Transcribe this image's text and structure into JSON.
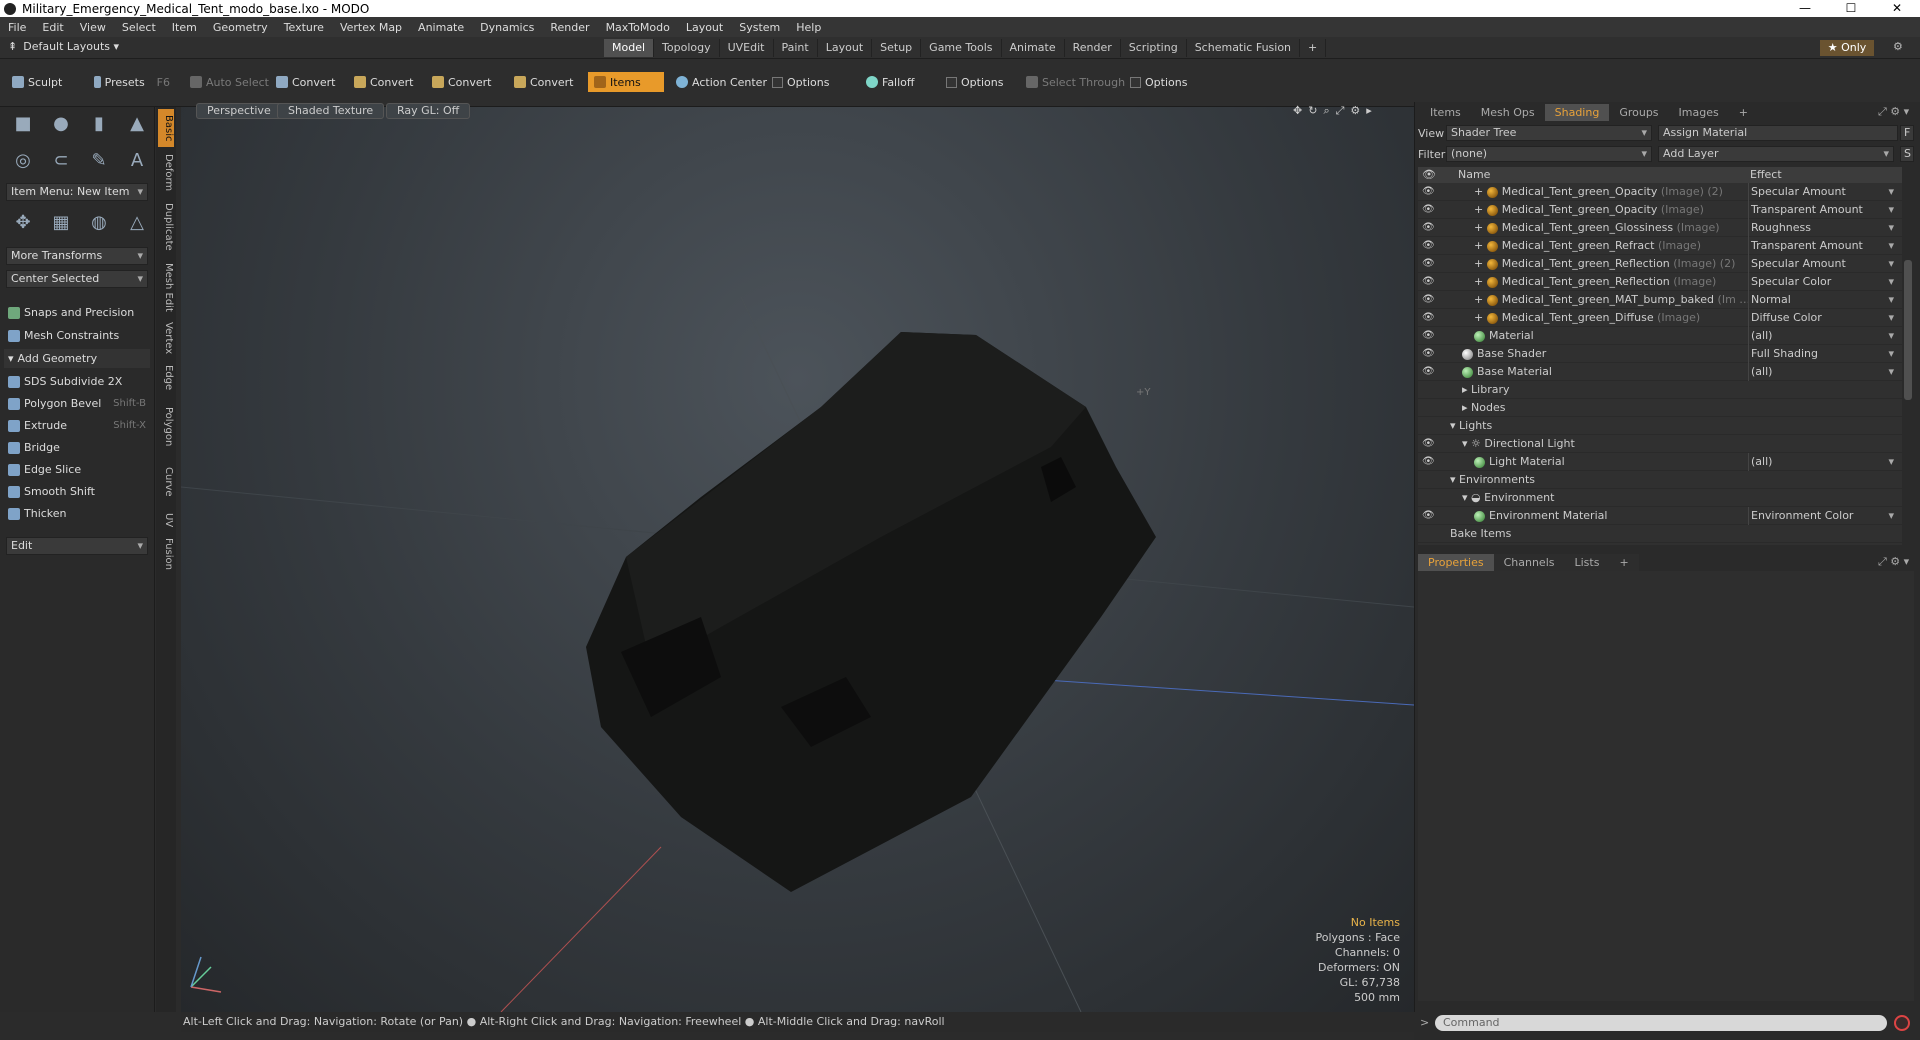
{
  "window": {
    "title": "Military_Emergency_Medical_Tent_modo_base.lxo - MODO",
    "min": "—",
    "max": "☐",
    "close": "✕"
  },
  "menu": [
    "File",
    "Edit",
    "View",
    "Select",
    "Item",
    "Geometry",
    "Texture",
    "Vertex Map",
    "Animate",
    "Dynamics",
    "Render",
    "MaxToModo",
    "Layout",
    "System",
    "Help"
  ],
  "layout": {
    "label": "Default Layouts ▾",
    "tabs": [
      "Model",
      "Topology",
      "UVEdit",
      "Paint",
      "Layout",
      "Setup",
      "Game Tools",
      "Animate",
      "Render",
      "Scripting",
      "Schematic Fusion",
      "+"
    ],
    "active_tab": "Model",
    "only": "★ Only"
  },
  "toolbar": {
    "sculpt": "Sculpt",
    "presets": "Presets",
    "presets_key": "F6",
    "auto_select": "Auto Select",
    "convert1": "Convert",
    "convert2": "Convert",
    "convert3": "Convert",
    "convert4": "Convert",
    "items": "Items",
    "action_center": "Action Center",
    "options1": "Options",
    "falloff": "Falloff",
    "options2": "Options",
    "select_through": "Select Through",
    "options3": "Options"
  },
  "left": {
    "item_menu": "Item Menu: New Item",
    "more_transforms": "More Transforms",
    "center_selected": "Center Selected",
    "snaps": "Snaps and Precision",
    "mesh_constraints": "Mesh Constraints",
    "add_geometry": "Add Geometry",
    "tools": [
      {
        "label": "SDS Subdivide 2X",
        "key": ""
      },
      {
        "label": "Polygon Bevel",
        "key": "Shift-B"
      },
      {
        "label": "Extrude",
        "key": "Shift-X"
      },
      {
        "label": "Bridge",
        "key": ""
      },
      {
        "label": "Edge Slice",
        "key": ""
      },
      {
        "label": "Smooth Shift",
        "key": ""
      },
      {
        "label": "Thicken",
        "key": ""
      }
    ],
    "edit": "Edit",
    "vtabs": [
      "Basic",
      "Deform",
      "Duplicate",
      "Mesh Edit",
      "Vertex",
      "Edge",
      "Polygon",
      "Curve",
      "UV",
      "Fusion"
    ]
  },
  "viewport": {
    "perspective": "Perspective",
    "shaded": "Shaded Texture",
    "raygl": "Ray GL: Off",
    "axis_label": "+Y",
    "stats": {
      "no_items": "No Items",
      "polygons": "Polygons : Face",
      "channels": "Channels: 0",
      "deformers": "Deformers: ON",
      "gl": "GL: 67,738",
      "size": "500 mm"
    }
  },
  "status": "Alt-Left Click and Drag: Navigation: Rotate (or Pan) ● Alt-Right Click and Drag: Navigation: Freewheel ● Alt-Middle Click and Drag: navRoll",
  "right": {
    "tabs": [
      "Items",
      "Mesh Ops",
      "Shading",
      "Groups",
      "Images",
      "+"
    ],
    "active_tab": "Shading",
    "view_label": "View",
    "view_value": "Shader Tree",
    "assign": "Assign Material",
    "f_btn": "F",
    "filter_label": "Filter",
    "filter_value": "(none)",
    "add_layer": "Add Layer",
    "s_btn": "S",
    "col_name": "Name",
    "col_effect": "Effect",
    "rows": [
      {
        "name": "Medical_Tent_green_Opacity",
        "sub": "(Image) (2)",
        "effect": "Specular Amount",
        "type": "img",
        "indent": 3,
        "plus": true,
        "eye": true
      },
      {
        "name": "Medical_Tent_green_Opacity",
        "sub": "(Image)",
        "effect": "Transparent Amount",
        "type": "img",
        "indent": 3,
        "plus": true,
        "eye": true
      },
      {
        "name": "Medical_Tent_green_Glossiness",
        "sub": "(Image)",
        "effect": "Roughness",
        "type": "img",
        "indent": 3,
        "plus": true,
        "eye": true
      },
      {
        "name": "Medical_Tent_green_Refract",
        "sub": "(Image)",
        "effect": "Transparent Amount",
        "type": "img",
        "indent": 3,
        "plus": true,
        "eye": true
      },
      {
        "name": "Medical_Tent_green_Reflection",
        "sub": "(Image) (2)",
        "effect": "Specular Amount",
        "type": "img",
        "indent": 3,
        "plus": true,
        "eye": true
      },
      {
        "name": "Medical_Tent_green_Reflection",
        "sub": "(Image)",
        "effect": "Specular Color",
        "type": "img",
        "indent": 3,
        "plus": true,
        "eye": true
      },
      {
        "name": "Medical_Tent_green_MAT_bump_baked",
        "sub": "(Im …",
        "effect": "Normal",
        "type": "img",
        "indent": 3,
        "plus": true,
        "eye": true
      },
      {
        "name": "Medical_Tent_green_Diffuse",
        "sub": "(Image)",
        "effect": "Diffuse Color",
        "type": "img",
        "indent": 3,
        "plus": true,
        "eye": true
      },
      {
        "name": "Material",
        "sub": "",
        "effect": "(all)",
        "type": "mat",
        "indent": 3,
        "plus": false,
        "eye": true
      },
      {
        "name": "Base Shader",
        "sub": "",
        "effect": "Full Shading",
        "type": "sh",
        "indent": 2,
        "plus": false,
        "eye": true
      },
      {
        "name": "Base Material",
        "sub": "",
        "effect": "(all)",
        "type": "mat",
        "indent": 2,
        "plus": false,
        "eye": true
      },
      {
        "name": "Library",
        "sub": "",
        "effect": "",
        "type": "folder",
        "indent": 2,
        "plus": false,
        "eye": false
      },
      {
        "name": "Nodes",
        "sub": "",
        "effect": "",
        "type": "folder",
        "indent": 2,
        "plus": false,
        "eye": false
      },
      {
        "name": "Lights",
        "sub": "",
        "effect": "",
        "type": "group",
        "indent": 1,
        "plus": false,
        "eye": false
      },
      {
        "name": "Directional Light",
        "sub": "",
        "effect": "",
        "type": "light",
        "indent": 2,
        "plus": false,
        "eye": true
      },
      {
        "name": "Light Material",
        "sub": "",
        "effect": "(all)",
        "type": "mat",
        "indent": 3,
        "plus": false,
        "eye": true
      },
      {
        "name": "Environments",
        "sub": "",
        "effect": "",
        "type": "group",
        "indent": 1,
        "plus": false,
        "eye": false
      },
      {
        "name": "Environment",
        "sub": "",
        "effect": "",
        "type": "env",
        "indent": 2,
        "plus": false,
        "eye": false
      },
      {
        "name": "Environment Material",
        "sub": "",
        "effect": "Environment Color",
        "type": "mat",
        "indent": 3,
        "plus": false,
        "eye": true
      },
      {
        "name": "Bake Items",
        "sub": "",
        "effect": "",
        "type": "none",
        "indent": 1,
        "plus": false,
        "eye": false
      }
    ],
    "ptabs": [
      "Properties",
      "Channels",
      "Lists",
      "+"
    ],
    "active_ptab": "Properties",
    "command_placeholder": "Command"
  }
}
